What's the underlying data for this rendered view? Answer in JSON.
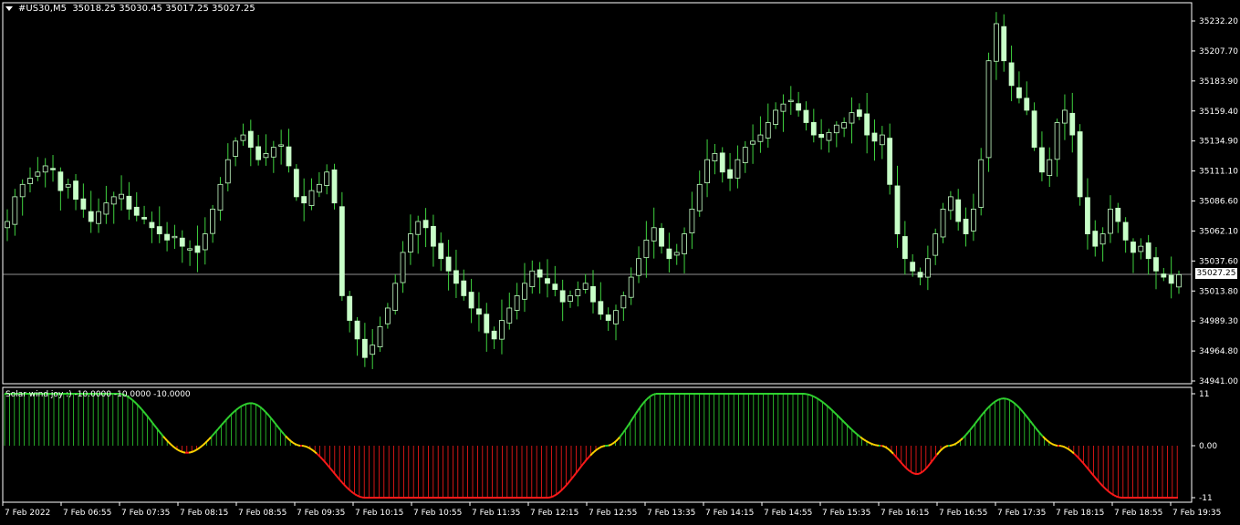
{
  "header": {
    "symbol": "#US30,M5",
    "ohlc": "35018.25 35030.45 35017.25 35027.25"
  },
  "indicator": {
    "label": "Solar wind joy :) -10.0000 -10.0000 -10.0000",
    "ticks": [
      "11",
      "0.00",
      "-11"
    ]
  },
  "price_axis": {
    "ticks": [
      "35232.20",
      "35207.70",
      "35183.90",
      "35159.40",
      "35134.90",
      "35111.10",
      "35086.60",
      "35062.10",
      "35037.60",
      "35013.80",
      "34989.30",
      "34964.80",
      "34941.00"
    ],
    "current_price": "35027.25"
  },
  "time_axis": {
    "labels": [
      "7 Feb 2022",
      "7 Feb 06:55",
      "7 Feb 07:35",
      "7 Feb 08:15",
      "7 Feb 08:55",
      "7 Feb 09:35",
      "7 Feb 10:15",
      "7 Feb 10:55",
      "7 Feb 11:35",
      "7 Feb 12:15",
      "7 Feb 12:55",
      "7 Feb 13:35",
      "7 Feb 14:15",
      "7 Feb 14:55",
      "7 Feb 15:35",
      "7 Feb 16:15",
      "7 Feb 16:55",
      "7 Feb 17:35",
      "7 Feb 18:15",
      "7 Feb 18:55",
      "7 Feb 19:35"
    ]
  },
  "colors": {
    "bull": "#c8ffc8",
    "bear": "#ffffff",
    "wick": "#3fd23f",
    "hist_pos": "#2fd22f",
    "hist_neg": "#ff1a1a",
    "hist_turn": "#ffd400",
    "frame": "#ffffff"
  },
  "chart_data": {
    "type": "candlestick",
    "ylim": [
      34941.0,
      35232.2
    ],
    "close_series": [
      35070,
      35090,
      35100,
      35105,
      35110,
      35115,
      35112,
      35095,
      35100,
      35088,
      35080,
      35070,
      35078,
      35085,
      35090,
      35092,
      35080,
      35075,
      35072,
      35065,
      35060,
      35055,
      35058,
      35050,
      35048,
      35045,
      35060,
      35080,
      35100,
      35120,
      35135,
      35140,
      35130,
      35120,
      35125,
      35130,
      35132,
      35115,
      35090,
      35085,
      35095,
      35100,
      35110,
      35085,
      35010,
      34990,
      34975,
      34960,
      34970,
      34985,
      35000,
      35020,
      35045,
      35060,
      35070,
      35065,
      35050,
      35040,
      35030,
      35020,
      35010,
      35000,
      34995,
      34980,
      34975,
      34990,
      35000,
      35010,
      35020,
      35030,
      35025,
      35020,
      35015,
      35005,
      35010,
      35015,
      35020,
      35005,
      34995,
      34990,
      34998,
      35010,
      35025,
      35040,
      35055,
      35065,
      35050,
      35040,
      35045,
      35060,
      35080,
      35100,
      35120,
      35125,
      35110,
      35105,
      35120,
      35130,
      35135,
      35140,
      35150,
      35160,
      35165,
      35168,
      35160,
      35150,
      35140,
      35138,
      35142,
      35148,
      35150,
      35158,
      35155,
      35140,
      35135,
      35140,
      35100,
      35060,
      35040,
      35030,
      35025,
      35040,
      35060,
      35080,
      35090,
      35070,
      35060,
      35080,
      35120,
      35200,
      35230,
      35200,
      35180,
      35170,
      35160,
      35130,
      35110,
      35120,
      35150,
      35160,
      35140,
      35090,
      35060,
      35050,
      35060,
      35080,
      35070,
      35055,
      35045,
      35050,
      35040,
      35030,
      35025,
      35020,
      35027
    ]
  }
}
